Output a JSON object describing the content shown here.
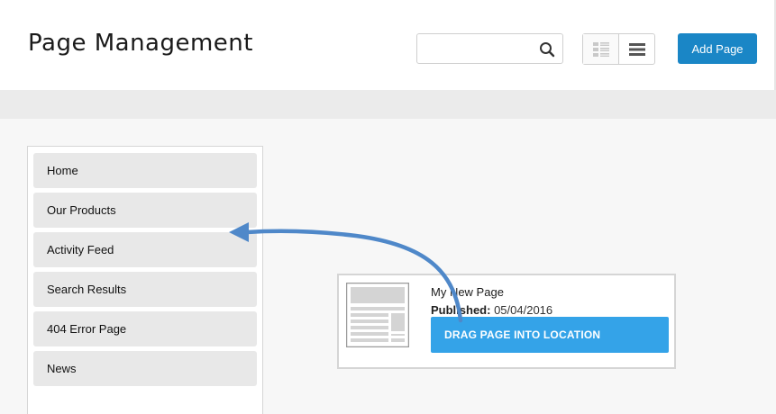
{
  "header": {
    "title": "Page Management",
    "search": {
      "value": "",
      "placeholder": "",
      "icon": "search-icon"
    },
    "view_toggle": {
      "options": [
        "grid-view-icon",
        "list-view-icon"
      ]
    },
    "add_button_label": "Add Page"
  },
  "sidebar": {
    "items": [
      {
        "label": "Home"
      },
      {
        "label": "Our Products"
      },
      {
        "label": "Activity Feed"
      },
      {
        "label": "Search Results"
      },
      {
        "label": "404 Error Page"
      },
      {
        "label": "News"
      }
    ]
  },
  "card": {
    "title": "My New Page",
    "published_label": "Published:",
    "published_date": "05/04/2016",
    "drag_label": "DRAG PAGE INTO LOCATION",
    "thumbnail_icon": "page-thumbnail-icon"
  },
  "colors": {
    "accent": "#1a86c6",
    "drag_bar": "#34a3e8",
    "arrow": "#4f88c9",
    "nav_item_bg": "#e8e8e8"
  }
}
